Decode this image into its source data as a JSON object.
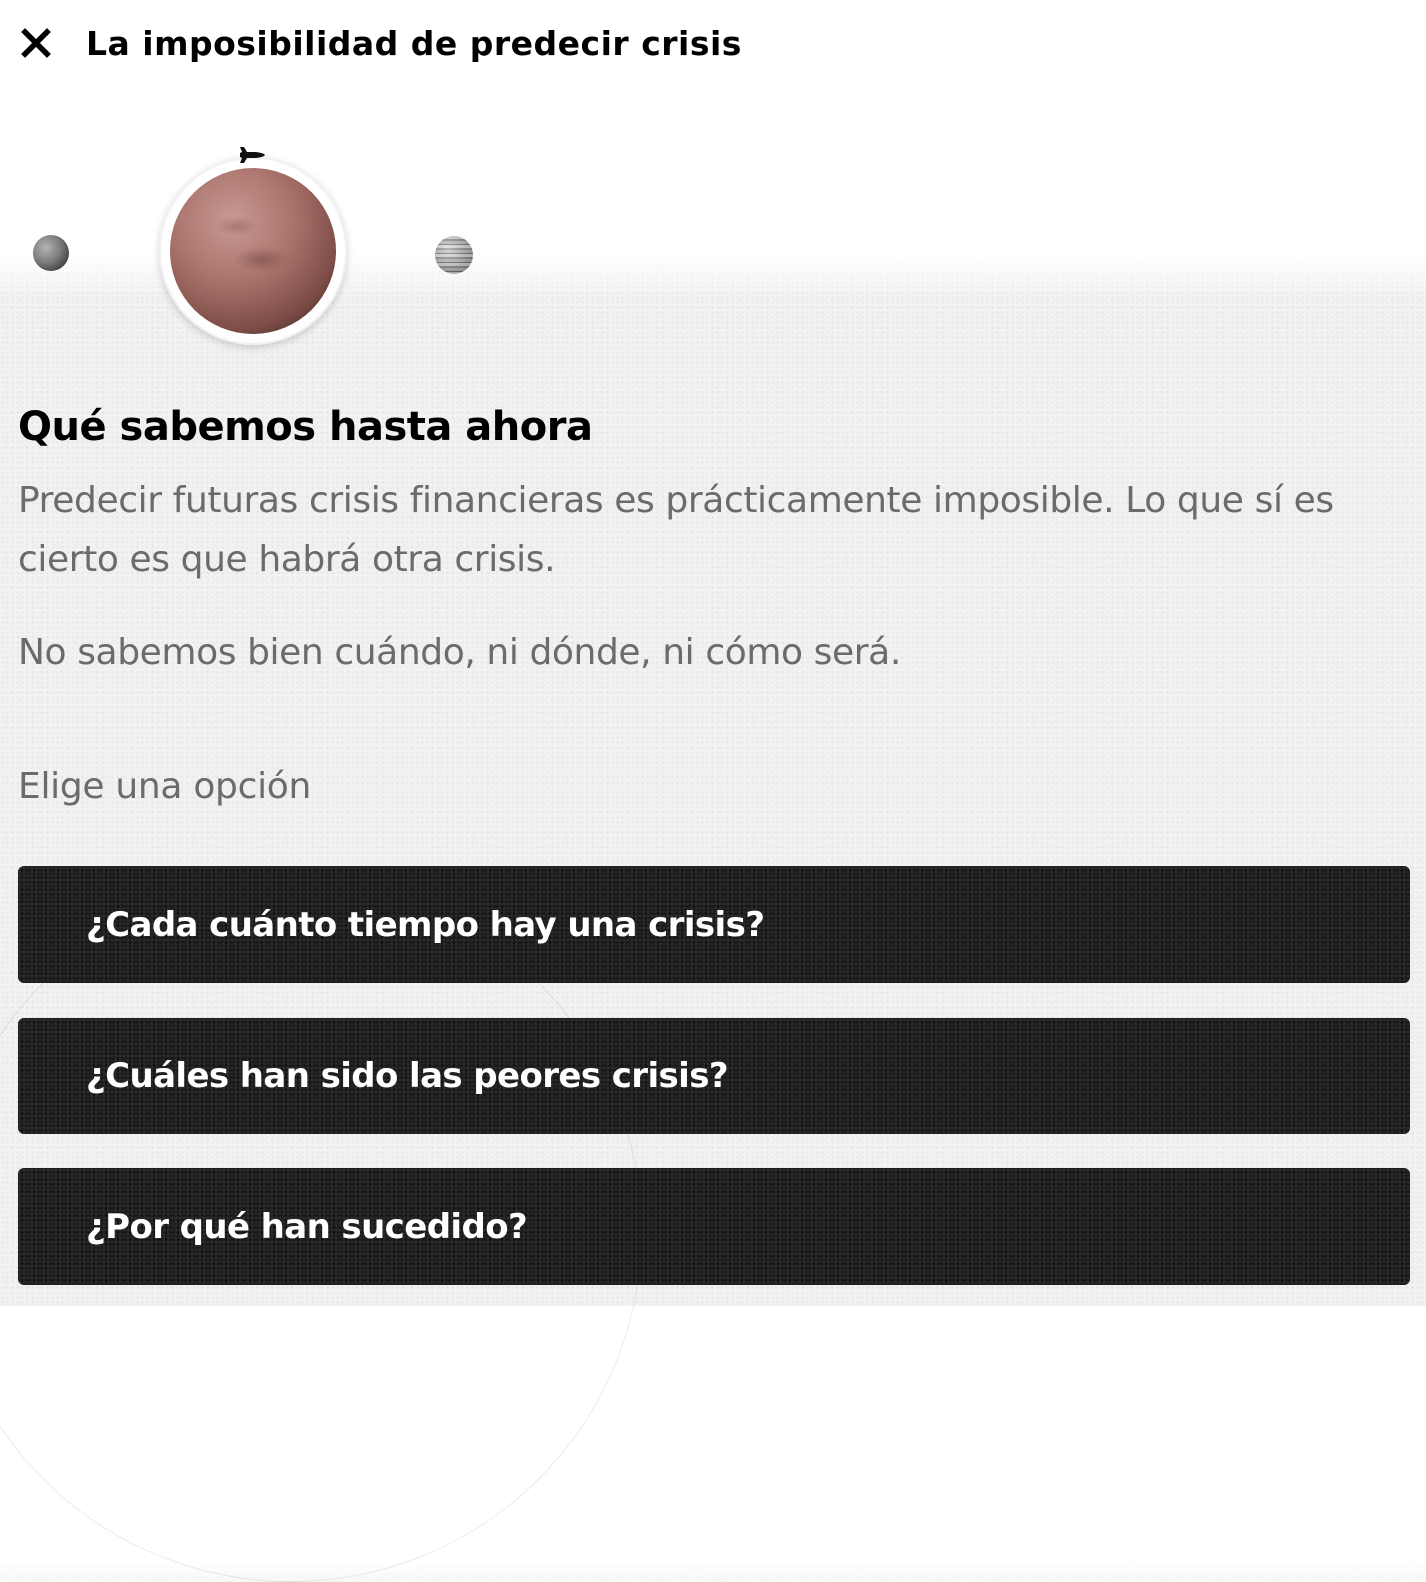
{
  "header": {
    "title": "La imposibilidad de predecir crisis",
    "close_icon": "close-icon"
  },
  "planets": {
    "items": [
      "moon-icon",
      "mars-icon",
      "jupiter-icon"
    ],
    "selected": "mars-icon",
    "marker_icon": "space-shuttle-icon"
  },
  "content": {
    "heading": "Qué sabemos hasta ahora",
    "paragraph1": "Predecir futuras crisis financieras es prácticamente imposible. Lo que sí es cierto es que habrá otra crisis.",
    "paragraph2": "No sabemos bien cuándo, ni dónde, ni cómo será."
  },
  "options": {
    "label": "Elige una opción",
    "items": [
      {
        "label": "¿Cada cuánto tiempo hay una crisis?"
      },
      {
        "label": "¿Cuáles han sido las peores crisis?"
      },
      {
        "label": "¿Por qué han sucedido?"
      }
    ]
  },
  "colors": {
    "button_background": "#1e1e1e",
    "button_text": "#ffffff",
    "body_text": "#6b6b6b",
    "heading_text": "#000000"
  }
}
